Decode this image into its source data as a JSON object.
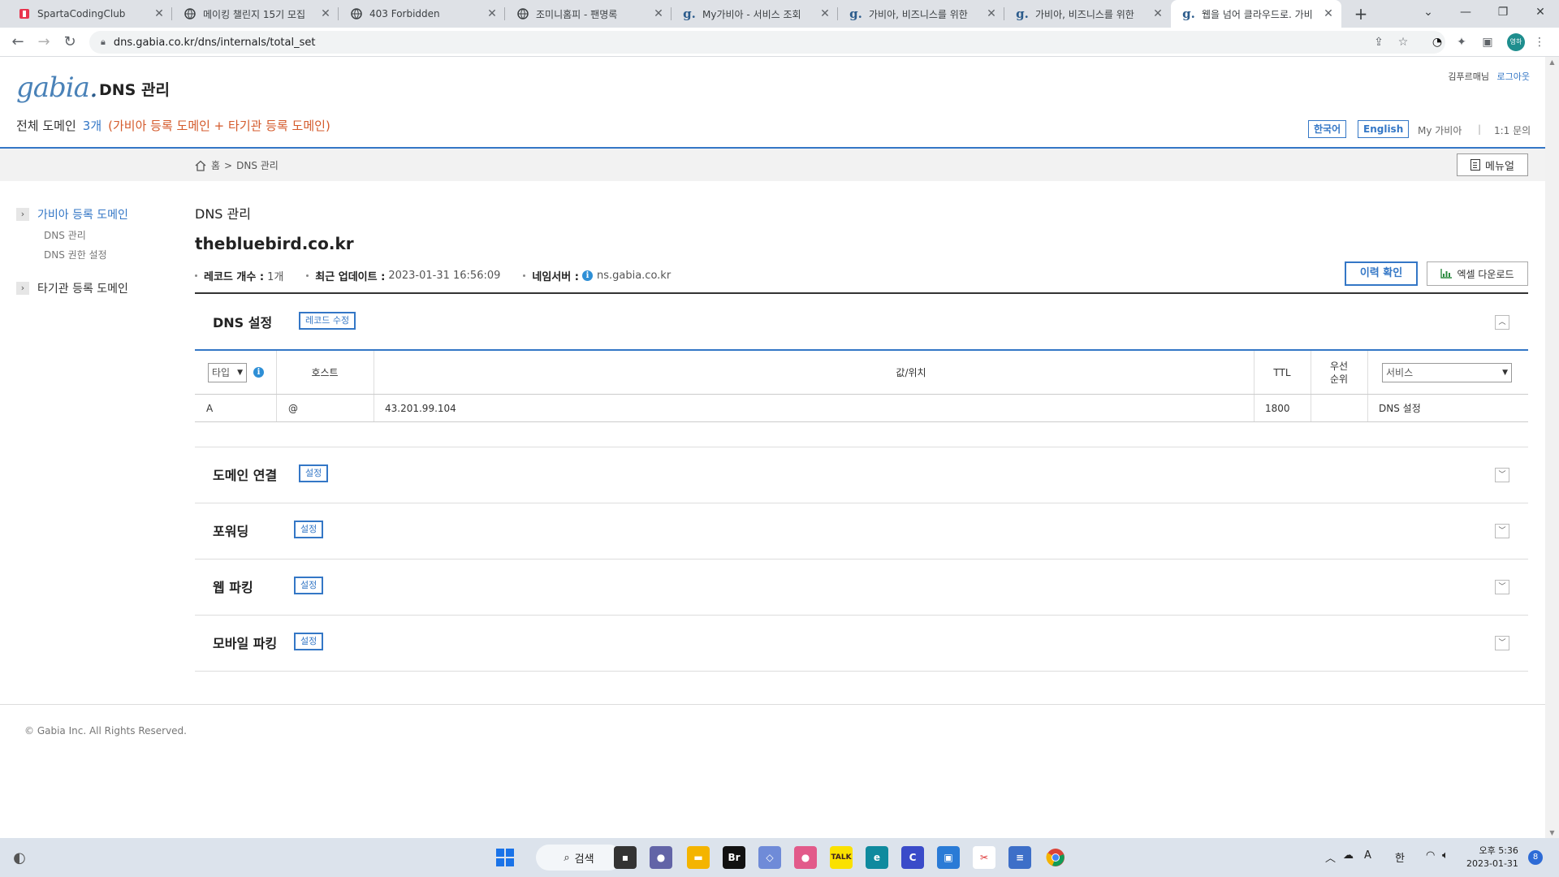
{
  "browser": {
    "tabs": [
      {
        "title": "SpartaCodingClub",
        "icon": "sparta-icon",
        "color": "#e8344e"
      },
      {
        "title": "메이킹 챌린지 15기 모집",
        "icon": "globe-icon"
      },
      {
        "title": "403 Forbidden",
        "icon": "globe-icon"
      },
      {
        "title": "조미니홈피 - 팬명록",
        "icon": "globe-icon"
      },
      {
        "title": "My가비아 - 서비스 조회",
        "icon": "gabia-icon"
      },
      {
        "title": "가비아, 비즈니스를 위한",
        "icon": "gabia-icon"
      },
      {
        "title": "가비아, 비즈니스를 위한",
        "icon": "gabia-icon"
      },
      {
        "title": "웹을 넘어 클라우드로. 가비",
        "icon": "gabia-icon",
        "active": true
      }
    ],
    "url": "dns.gabia.co.kr/dns/internals/total_set",
    "profile_initials": "영하"
  },
  "header": {
    "logo_text": "gabia",
    "logo_dot": ".",
    "service_title": "DNS 관리",
    "user_name": "김푸르매님",
    "logout": "로그아웃",
    "summary_label": "전체 도메인",
    "summary_count": "3개",
    "summary_desc": "(가비아 등록 도메인 + 타기관 등록 도메인)",
    "lang_ko": "한국어",
    "lang_en": "English",
    "my_gabia": "My 가비아",
    "separator": "|",
    "inquiry": "1:1 문의"
  },
  "breadcrumb": {
    "home": "홈",
    "sep": ">",
    "current": "DNS 관리"
  },
  "manual_button": "메뉴얼",
  "sidebar": {
    "groups": [
      {
        "label": "가비아 등록 도메인",
        "arrow": "›",
        "items": [
          "DNS 관리",
          "DNS 권한 설정"
        ]
      },
      {
        "label": "타기관 등록 도메인",
        "arrow": "›"
      }
    ]
  },
  "main": {
    "title": "DNS 관리",
    "domain": "thebluebird.co.kr",
    "record_count_label": "레코드 개수 :",
    "record_count": "1개",
    "updated_label": "최근 업데이트 :",
    "updated": "2023-01-31 16:56:09",
    "ns_label": "네임서버 :",
    "ns": "ns.gabia.co.kr",
    "history_button": "이력 확인",
    "excel_button": "엑셀 다운로드",
    "dns_section": {
      "title": "DNS 설정",
      "edit_button": "레코드 수정",
      "table": {
        "type_select": "타입",
        "headers": {
          "host": "호스트",
          "value": "값/위치",
          "ttl": "TTL",
          "priority_1": "우선",
          "priority_2": "순위"
        },
        "service_select": "서비스",
        "rows": [
          {
            "type": "A",
            "host": "@",
            "value": "43.201.99.104",
            "ttl": "1800",
            "priority": "",
            "service": "DNS 설정"
          }
        ]
      }
    },
    "sections": [
      {
        "title": "도메인 연결",
        "button": "설정"
      },
      {
        "title": "포워딩",
        "button": "설정"
      },
      {
        "title": "웹 파킹",
        "button": "설정"
      },
      {
        "title": "모바일 파킹",
        "button": "설정"
      }
    ]
  },
  "footer": {
    "copyright": "© Gabia Inc. All Rights Reserved."
  },
  "taskbar": {
    "search": "검색",
    "ime_a": "A",
    "ime_han": "한",
    "time": "오후 5:36",
    "date": "2023-01-31",
    "notifications": "8"
  }
}
